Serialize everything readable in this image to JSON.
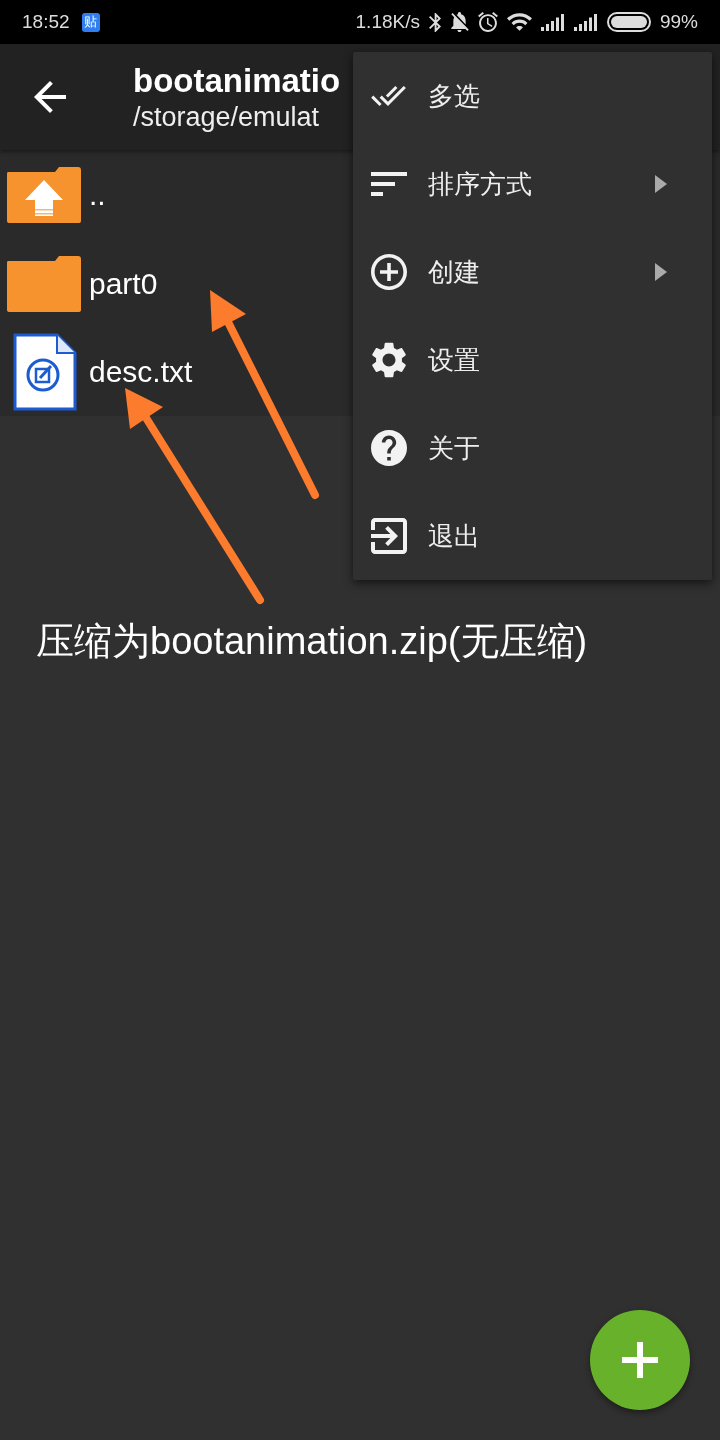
{
  "status_bar": {
    "time": "18:52",
    "notification": "贴",
    "speed": "1.18K/s",
    "battery": "99%"
  },
  "app_bar": {
    "title": "bootanimatio",
    "path": "/storage/emulat"
  },
  "files": [
    {
      "kind": "parent",
      "name": ".."
    },
    {
      "kind": "folder",
      "name": "part0"
    },
    {
      "kind": "file",
      "name": "desc.txt"
    }
  ],
  "menu": {
    "items": [
      {
        "label": "多选",
        "submenu": false
      },
      {
        "label": "排序方式",
        "submenu": true
      },
      {
        "label": "创建",
        "submenu": true
      },
      {
        "label": "设置",
        "submenu": false
      },
      {
        "label": "关于",
        "submenu": false
      },
      {
        "label": "退出",
        "submenu": false
      }
    ]
  },
  "annotation": {
    "caption": "压缩为bootanimation.zip(无压缩)"
  }
}
